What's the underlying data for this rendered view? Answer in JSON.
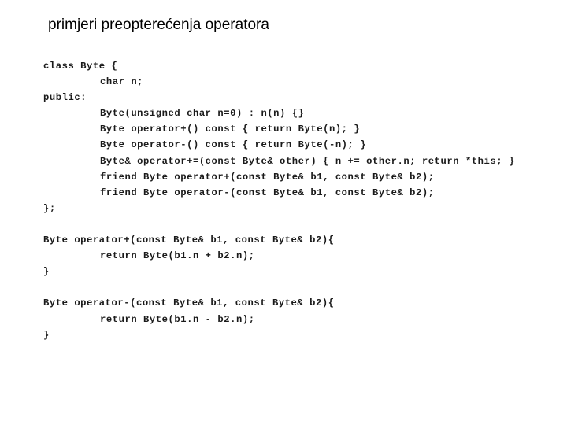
{
  "slide": {
    "title": "primjeri preopterećenja operatora"
  },
  "code": {
    "class_block": [
      {
        "text": "class Byte {",
        "indent": 0
      },
      {
        "text": "char n;",
        "indent": 1
      },
      {
        "text": "public:",
        "indent": 0
      },
      {
        "text": "Byte(unsigned char n=0) : n(n) {}",
        "indent": 1
      },
      {
        "text": "Byte operator+() const { return Byte(n); }",
        "indent": 1
      },
      {
        "text": "Byte operator-() const { return Byte(-n); }",
        "indent": 1
      },
      {
        "text": "Byte& operator+=(const Byte& other) { n += other.n; return *this; }",
        "indent": 1
      },
      {
        "text": "friend Byte operator+(const Byte& b1, const Byte& b2);",
        "indent": 1
      },
      {
        "text": "friend Byte operator-(const Byte& b1, const Byte& b2);",
        "indent": 1
      },
      {
        "text": "};",
        "indent": 0
      }
    ],
    "plus_function": [
      {
        "text": "Byte operator+(const Byte& b1, const Byte& b2){",
        "indent": 0
      },
      {
        "text": "return Byte(b1.n + b2.n);",
        "indent": 1
      },
      {
        "text": "}",
        "indent": 0
      }
    ],
    "minus_function": [
      {
        "text": "Byte operator-(const Byte& b1, const Byte& b2){",
        "indent": 0
      },
      {
        "text": "return Byte(b1.n - b2.n);",
        "indent": 1
      },
      {
        "text": "}",
        "indent": 0
      }
    ]
  }
}
